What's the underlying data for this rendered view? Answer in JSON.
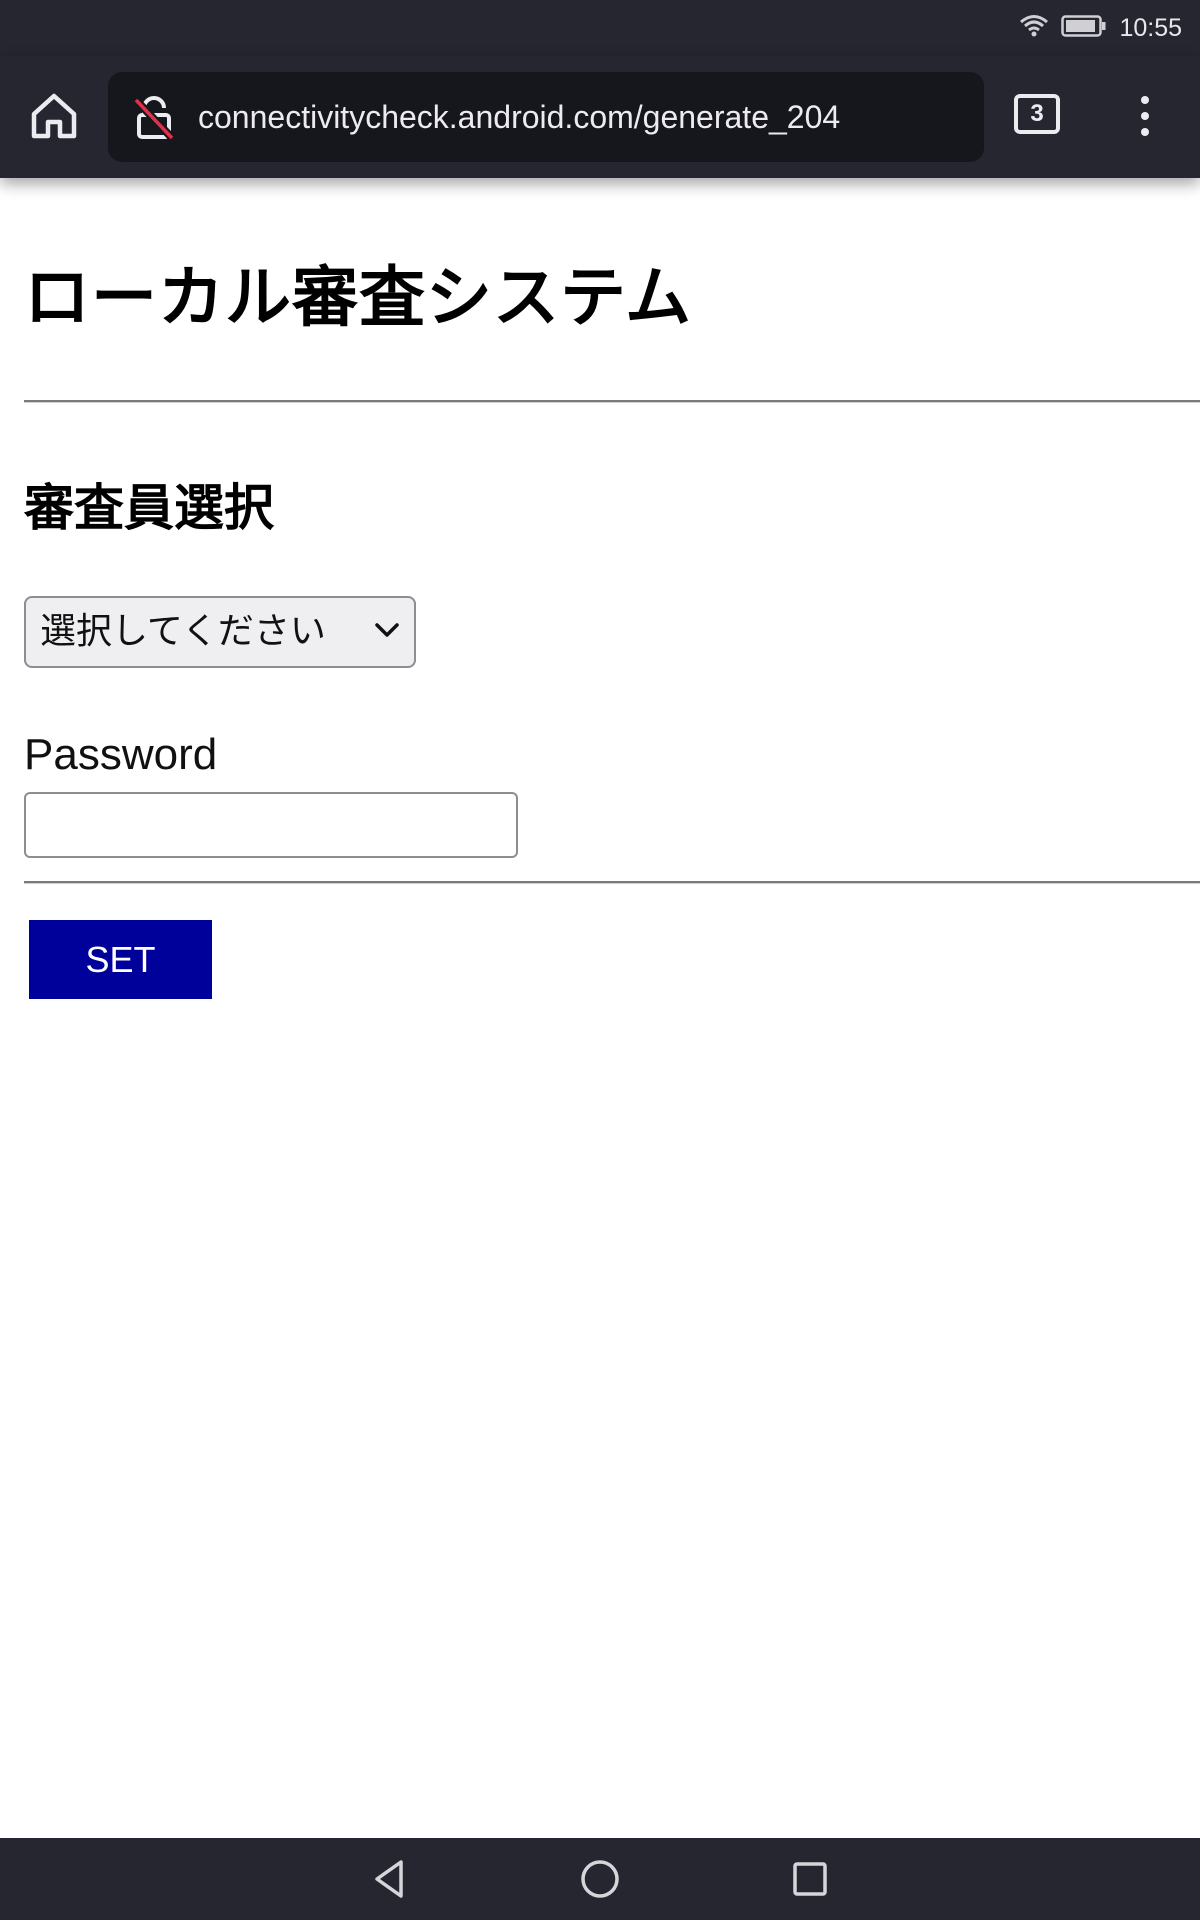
{
  "status_bar": {
    "time": "10:55",
    "icons": [
      "wifi-icon",
      "battery-icon"
    ]
  },
  "browser": {
    "url": "connectivitycheck.android.com/generate_204",
    "tab_count": "3",
    "icons": [
      "home-icon",
      "not-secure-lock-icon",
      "more-vert-icon"
    ]
  },
  "page": {
    "title": "ローカル審査システム",
    "section_title": "審査員選択",
    "select": {
      "selected": "選択してください"
    },
    "password": {
      "label": "Password",
      "value": ""
    },
    "set_button_label": "SET"
  },
  "colors": {
    "chrome_bg": "#262630",
    "url_bg": "#16161d",
    "button_bg": "#00009a",
    "insecure_slash": "#e0304a"
  },
  "nav_bar": {
    "icons": [
      "back-icon",
      "home-circle-icon",
      "recents-icon"
    ]
  }
}
